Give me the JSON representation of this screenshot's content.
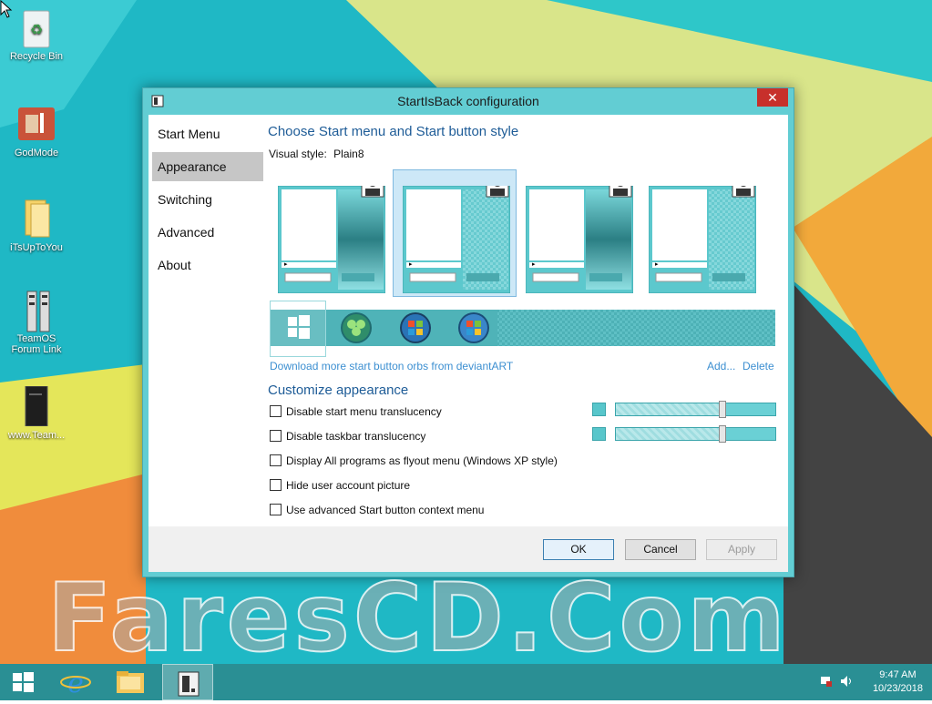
{
  "desktop": {
    "icons": [
      {
        "label": "Recycle Bin",
        "icon": "recycle-bin-icon"
      },
      {
        "label": "GodMode",
        "icon": "godmode-icon"
      },
      {
        "label": "iTsUpToYou",
        "icon": "folder-icon"
      },
      {
        "label": "TeamOS\nForum Link",
        "icon": "shortcut-icon"
      },
      {
        "label": "www.Team...",
        "icon": "document-icon"
      }
    ]
  },
  "window": {
    "title": "StartIsBack configuration",
    "close_label": "✕",
    "nav": [
      "Start Menu",
      "Appearance",
      "Switching",
      "Advanced",
      "About"
    ],
    "selected_nav": "Appearance",
    "style_heading": "Choose Start menu and Start button style",
    "visual_style_label": "Visual style:",
    "visual_style_value": "Plain8",
    "download_link": "Download more start button orbs from deviantART",
    "add_link": "Add...",
    "delete_link": "Delete",
    "customize_heading": "Customize appearance",
    "options": [
      {
        "label": "Disable start menu translucency",
        "checked": false
      },
      {
        "label": "Disable taskbar translucency",
        "checked": false
      },
      {
        "label": "Display All programs as flyout menu (Windows XP style)",
        "checked": false
      },
      {
        "label": "Hide user account picture",
        "checked": false
      },
      {
        "label": "Use advanced Start button context menu",
        "checked": false
      }
    ],
    "sliders": [
      0.66,
      0.66
    ],
    "buttons": {
      "ok": "OK",
      "cancel": "Cancel",
      "apply": "Apply"
    },
    "accent_color": "#5cc8cd"
  },
  "taskbar": {
    "time": "9:47 AM",
    "date": "10/23/2018"
  },
  "watermark": "FaresCD.Com"
}
